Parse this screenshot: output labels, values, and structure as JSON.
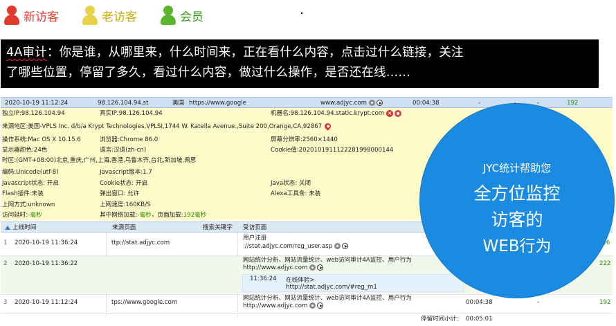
{
  "legend": {
    "new_visitor": {
      "label": "新访客",
      "color": "#e23b2e"
    },
    "old_visitor": {
      "label": "老访客",
      "color": "#c9a800"
    },
    "member": {
      "label": "会员",
      "color": "#3a9b1c"
    }
  },
  "banner": {
    "title": "4A审计",
    "line1": "：你是谁，从哪里来，什么时间来，正在看什么内容，点击过什么链接，关注",
    "line2": "了哪些位置，停留了多久，看过什么内容，做过什么操作，是否还在线……"
  },
  "session": {
    "time": "2020-10-19 11:12:24",
    "ip": "98.126.104.94.st",
    "country": "美国",
    "referrer": "https://www.google",
    "site": "www.adjyc.com",
    "duration": "00:04:38",
    "dash1": "-",
    "dash2": "-",
    "dash3": "-",
    "count": "192"
  },
  "details": {
    "local_ip": "独立IP:98.126.104.94",
    "real_ip": "真实IP:98.126.104.94",
    "machine": "机器名:98.126.104.94.static.krypt.com",
    "region": "来源地区:美国-VPLS Inc. d/b/a Krypt Technologies,VPLSI,1744 W. Katella Avenue.,Suite 200,Orange,CA,92867",
    "os": "操作系统:Mac OS X 10.15.6",
    "browser": "浏览器:Chrome 86.0",
    "resolution": "屏幕分辨率:2560×1440",
    "color_depth": "显示器颜色:24色",
    "language": "语言:汉语(zh-cn)",
    "cookie_val": "Cookie值:20201019111222819980001​44",
    "timezone": "时区:(GMT+08:00)北京,重庆,广州,上海,香港,乌鲁木齐,台北,新加坡,佩思",
    "encoding": "编码:Unicode(utf-8)",
    "js_version": "Javascript版本:1.7",
    "js_status": "Javascript状态: 开启",
    "cookie_status": "Cookie状态: 开启",
    "java_status": "Java状态: 关闭",
    "flash": "Flash插件:未装",
    "popup": "弹出窗口: 允许",
    "alexa": "Alexa工具条: 未装",
    "net_type": "上网方式:unknown",
    "net_speed": "上网速度:160KB/S",
    "delay_label": "访问延时:",
    "delay_value": "-毫秒",
    "load_label": "其中网络加载:",
    "load_value": "-毫秒",
    "page_load_label": "，页面加载:",
    "page_load_value": "192毫秒"
  },
  "list_header": {
    "login_time": "上线时间",
    "source_page": "来源页面",
    "keyword": "搜索关键字",
    "visited_page": "受访页面"
  },
  "rows": [
    {
      "index": "1",
      "time": "2020-10-19 11:36:24",
      "source": "ttp://stat.adjyc.com",
      "page_title": "用户注册",
      "page_url": "://stat.adjyc.com/reg_user.asp",
      "right": "/6"
    },
    {
      "index": "2",
      "time": "2020-10-19 11:36:22",
      "source": "",
      "page_title": "网站统计分析、网站流量统计、web访问审计4A监控、用户行为",
      "page_url": "http://www.adjyc.com",
      "right": "222"
    },
    {
      "index": "3",
      "time": "2020-10-19 11:12:24",
      "source": "tps://www.google.com",
      "page_title": "网站统计分析、网站流量统计、web访问审计4A监控、用户行为",
      "page_url": "http://www.adjyc.com",
      "duration": "00:04:38",
      "right": "192"
    }
  ],
  "sub_row": {
    "time": "11:36:24",
    "label": "在线体验>",
    "url": "http://stat.adjyc.com/#reg_m1"
  },
  "footer": {
    "stay_label": "停留时间小计:",
    "stay_value": "00:05:01"
  },
  "promo": {
    "line1": "JYC统计帮助您",
    "line2": "全方位监控",
    "line3": "访客的",
    "line4": "WEB行为"
  }
}
